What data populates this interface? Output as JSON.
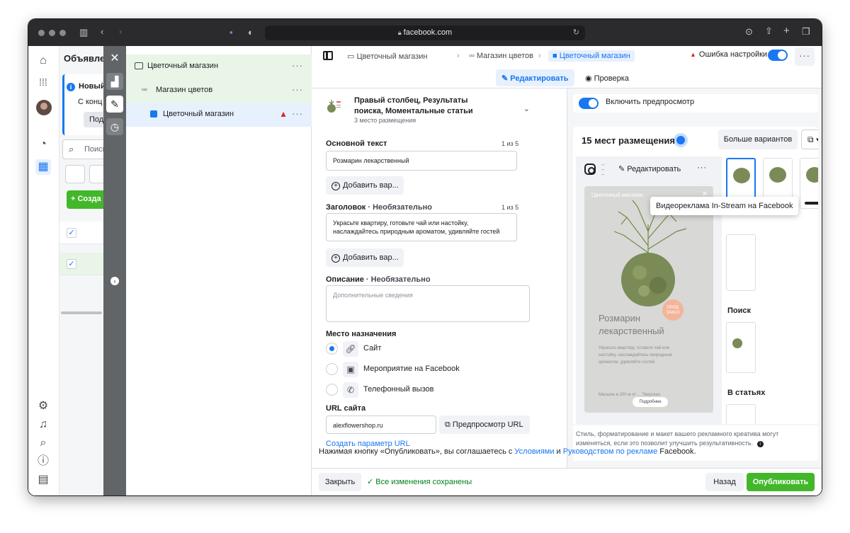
{
  "browser": {
    "url": "facebook.com"
  },
  "background": {
    "page_title": "Объявле",
    "notice_title": "Новый",
    "notice_text": "С конц",
    "notice_button": "Под",
    "search_placeholder": "Поиск",
    "create_button": "+ Созда"
  },
  "tree": {
    "campaign": "Цветочный магазин",
    "adset": "Магазин цветов",
    "ad": "Цветочный магазин",
    "dots": "···"
  },
  "breadcrumbs": {
    "campaign": "Цветочный магазин",
    "adset": "Магазин цветов",
    "ad": "Цветочный магазин",
    "separator": "›"
  },
  "topbar": {
    "error_label": "Ошибка настройки",
    "more": "···"
  },
  "tabs": {
    "edit": "Редактировать",
    "review": "Проверка"
  },
  "form": {
    "placement_title": "Правый столбец, Результаты поиска, Моментальные статьи",
    "placement_count": "3 место размещения",
    "primary_text_label": "Основной текст",
    "primary_text_counter": "1 из 5",
    "primary_text_value": "Розмарин лекарственный",
    "add_variant": "Добавить вар...",
    "headline_label": "Заголовок",
    "headline_optional": " · Необязательно",
    "headline_counter": "1 из 5",
    "headline_value": "Украсьте квартиру, готовьте чай или настойку, наслаждайтесь природным ароматом, удивляйте гостей",
    "description_label": "Описание",
    "description_optional": " · Необязательно",
    "description_placeholder": "Дополнительные сведения",
    "destination_label": "Место назначения",
    "destinations": [
      {
        "label": "Сайт",
        "selected": true
      },
      {
        "label": "Мероприятие на Facebook",
        "selected": false
      },
      {
        "label": "Телефонный вызов",
        "selected": false
      }
    ],
    "url_label": "URL сайта",
    "url_value": "alexflowershop.ru",
    "url_preview": "Предпросмотр URL",
    "url_param_link": "Создать параметр URL"
  },
  "preview": {
    "toggle_label": "Включить предпросмотр",
    "placements_heading": "15 мест размещения",
    "more_options": "Больше вариантов",
    "edit_button": "Редактировать",
    "ad_brand": "Цветочный магазин",
    "ad_title": "Розмарин лекарственный",
    "ad_body": "Украсьте квартиру, готовьте чай или настойку, наслаждайтесь природным ароматом, удивляйте гостей",
    "ad_footer": "Магазин в 200 м от ... Тверская",
    "ad_cta": "Подробнее",
    "ad_badge": "ПРОБ ЗАКАЗ",
    "tooltip": "Видеореклама In-Stream на Facebook",
    "section_search": "Поиск",
    "section_articles": "В статьях",
    "note": "Стиль, форматирование и макет вашего рекламного креатива могут изменяться, если это позволит улучшить результативность."
  },
  "footer": {
    "legal_prefix": "Нажимая кнопку «Опубликовать», вы соглашаетесь с ",
    "legal_terms": "Условиями",
    "legal_and": " и ",
    "legal_guide": "Руководством по рекламе",
    "legal_suffix": " Facebook.",
    "close": "Закрыть",
    "saved": "Все изменения сохранены",
    "back": "Назад",
    "publish": "Опубликовать"
  },
  "colors": {
    "accent": "#1877f2",
    "success": "#42b72a",
    "error": "#e02525",
    "strip": "#626567"
  }
}
